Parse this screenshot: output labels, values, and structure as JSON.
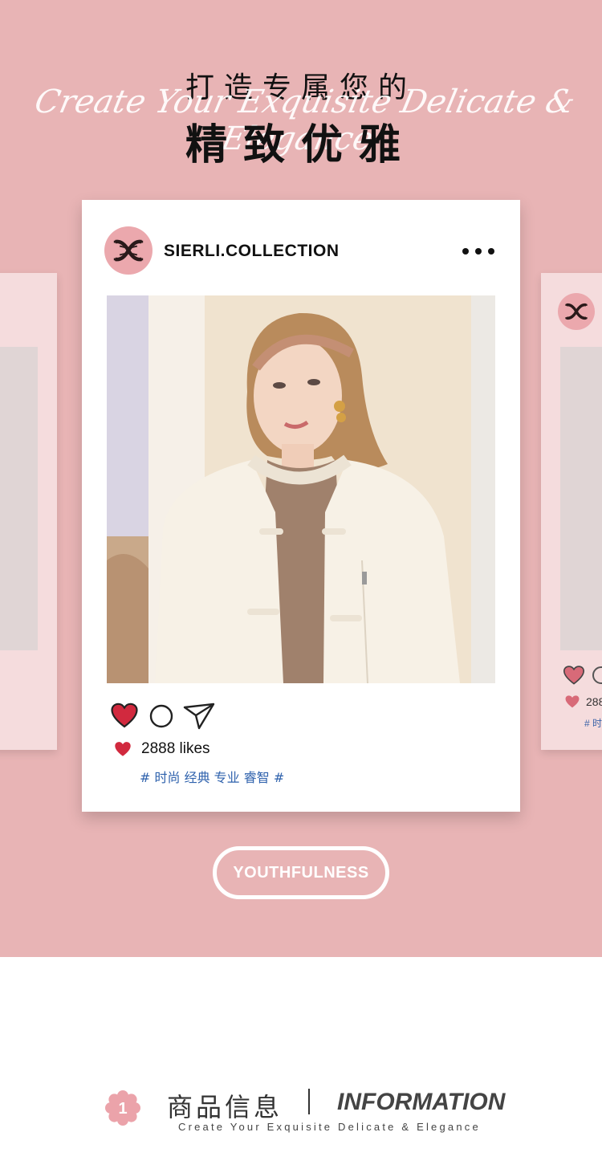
{
  "hero": {
    "title_line1": "打造专属您的",
    "script_line": "Create Your Exquisite Delicate & Elegance",
    "title_line2": "精致优雅"
  },
  "post": {
    "username": "SIERLI.COLLECTION",
    "avatar_icon": "sierli-logo-icon",
    "more_icon": "more-dots-icon",
    "photo_subject": "woman-in-cream-jacket",
    "actions": [
      "heart-icon",
      "comment-icon",
      "send-icon"
    ],
    "likes": "2888 likes",
    "tags": "# 时尚 经典 专业 睿智 #"
  },
  "side_card_right": {
    "likes": "288",
    "tags": "# 时"
  },
  "badge": {
    "label": "YOUTHFULNESS"
  },
  "section": {
    "number": "1",
    "title_cn": "商品信息",
    "title_en": "INFORMATION",
    "subtitle": "Create Your Exquisite Delicate & Elegance"
  },
  "colors": {
    "hero_bg": "#e8b4b5",
    "avatar_bg": "#eba8ad",
    "heart": "#d1293e",
    "tag": "#2f62ad",
    "flower": "#eba3aa"
  }
}
